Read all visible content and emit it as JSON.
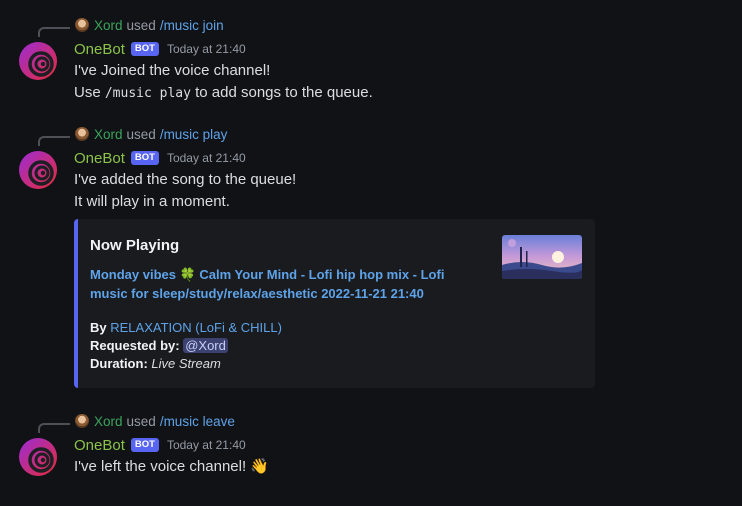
{
  "messages": [
    {
      "reply": {
        "user": "Xord",
        "used": "used",
        "command": "/music join"
      },
      "author": "OneBot",
      "bot_tag": "BOT",
      "timestamp": "Today at 21:40",
      "lines": [
        "I've Joined the voice channel!"
      ],
      "line2_pre": "Use ",
      "line2_code": "/music play",
      "line2_post": " to add songs to the queue."
    },
    {
      "reply": {
        "user": "Xord",
        "used": "used",
        "command": "/music play"
      },
      "author": "OneBot",
      "bot_tag": "BOT",
      "timestamp": "Today at 21:40",
      "lines": [
        "I've added the song to the queue!",
        "It will play in a moment."
      ],
      "embed": {
        "title": "Now Playing",
        "desc_part1": "Monday vibes ",
        "desc_emoji": "🍀",
        "desc_part2": " Calm Your Mind - Lofi hip hop mix - Lofi music for sleep/study/relax/aesthetic 2022-11-21 21:40",
        "by_label": "By",
        "by_value": "RELAXATION (LoFi & CHILL)",
        "requested_label": "Requested by:",
        "requested_value": "@Xord",
        "duration_label": "Duration:",
        "duration_value": "Live Stream"
      }
    },
    {
      "reply": {
        "user": "Xord",
        "used": "used",
        "command": "/music leave"
      },
      "author": "OneBot",
      "bot_tag": "BOT",
      "timestamp": "Today at 21:40",
      "lines": [
        "I've left the voice channel!"
      ],
      "emoji": "👋"
    }
  ],
  "colors": {
    "background": "#111216",
    "username": "#8bc34a",
    "reply_user": "#3ba55c",
    "link": "#5ea3e8",
    "bot_tag": "#5865f2",
    "embed_bar": "#5865f2"
  },
  "icons": {
    "avatar": "onebot-avatar",
    "reply_avatar": "xord-avatar"
  }
}
